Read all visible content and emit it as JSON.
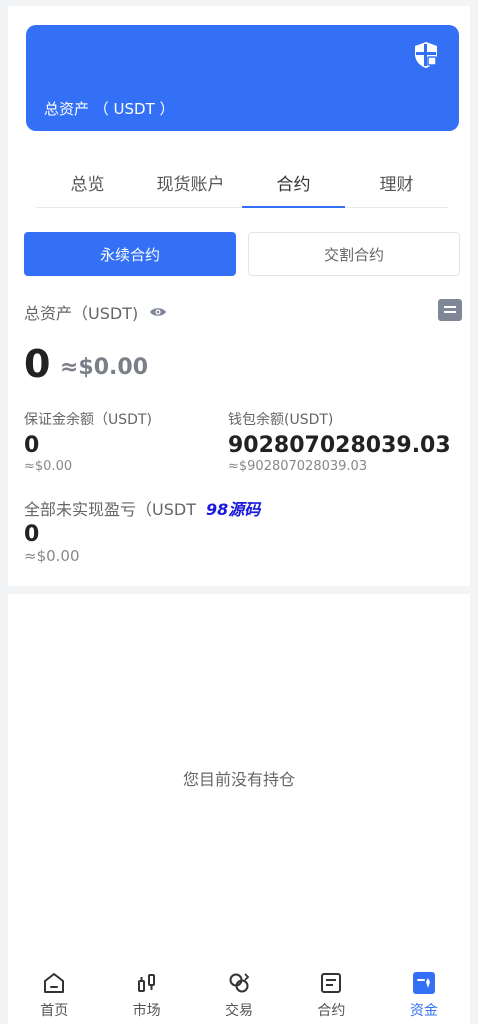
{
  "banner": {
    "label": "总资产 （ USDT ）",
    "icon": "shield-icon"
  },
  "tabs": [
    {
      "label": "总览"
    },
    {
      "label": "现货账户"
    },
    {
      "label": "合约",
      "active": true
    },
    {
      "label": "理财"
    }
  ],
  "segments": {
    "perpetual": "永续合约",
    "delivery": "交割合约"
  },
  "summary": {
    "total_label": "总资产（USDT)",
    "total_value": "0",
    "total_approx": "≈$0.00"
  },
  "margin": {
    "label": "保证金余额（USDT)",
    "value": "0",
    "approx": "≈$0.00"
  },
  "wallet": {
    "label": "钱包余额(USDT)",
    "value": "902807028039.03",
    "approx": "≈$902807028039.03"
  },
  "unrealized": {
    "label": "全部未实现盈亏（USDT",
    "value": "0",
    "approx": "≈$0.00"
  },
  "watermark": "98源码",
  "empty_text": "您目前没有持仓",
  "nav": [
    {
      "label": "首页",
      "icon": "home-icon"
    },
    {
      "label": "市场",
      "icon": "market-icon"
    },
    {
      "label": "交易",
      "icon": "trade-icon"
    },
    {
      "label": "合约",
      "icon": "contract-icon"
    },
    {
      "label": "资金",
      "icon": "wallet-icon",
      "active": true
    }
  ],
  "colors": {
    "accent": "#3370f5",
    "background": "#f3f4f6"
  }
}
